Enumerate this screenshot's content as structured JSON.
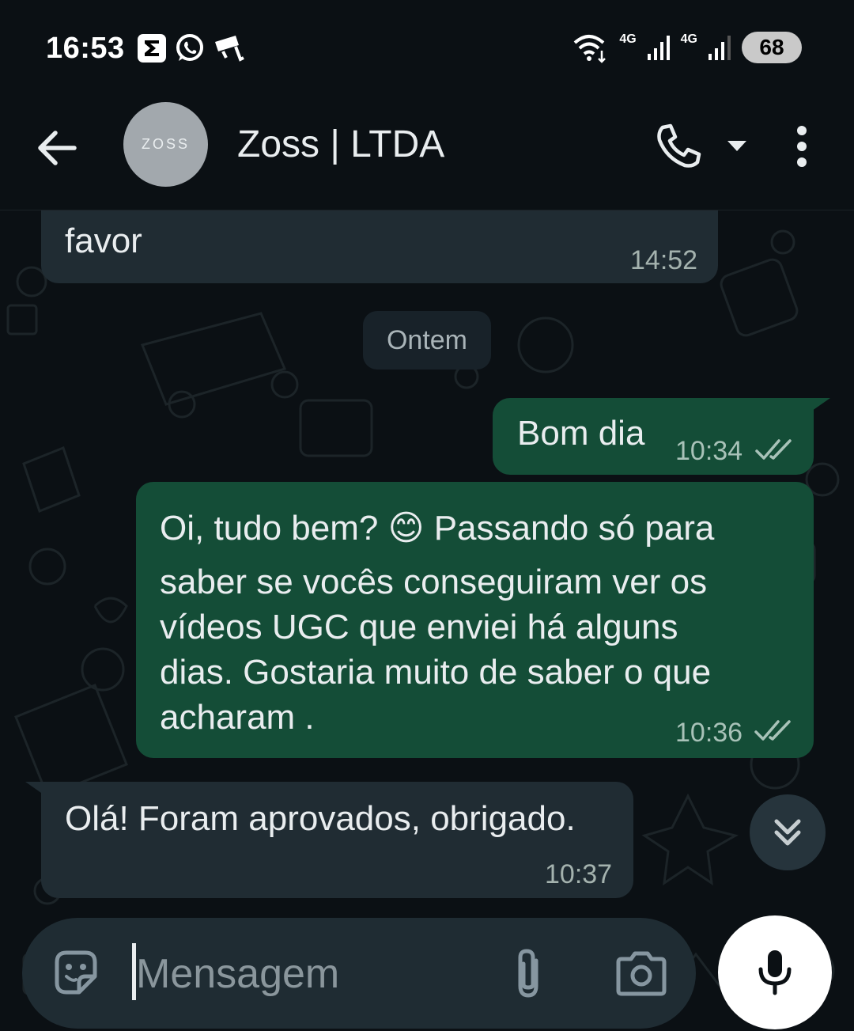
{
  "status_bar": {
    "time": "16:53",
    "net_1": "4G",
    "net_2": "4G",
    "battery": "68"
  },
  "header": {
    "avatar_text": "ZOSS",
    "contact_name": "Zoss | LTDA"
  },
  "messages": [
    {
      "direction": "in",
      "text": "favor",
      "time": "14:52"
    },
    {
      "direction": "out",
      "text": "Bom dia",
      "time": "10:34",
      "status": "read"
    },
    {
      "direction": "out",
      "text_1": "Oi, tudo bem? 😊 Passando só para",
      "text_2": "saber se vocês conseguiram ver os",
      "text_3": "vídeos UGC que enviei há alguns",
      "text_4": "dias. Gostaria muito de saber o que",
      "text_5": "acharam .",
      "time": "10:36",
      "status": "read"
    },
    {
      "direction": "in",
      "text": "Olá! Foram aprovados, obrigado.",
      "time": "10:37"
    }
  ],
  "date_separator": "Ontem",
  "composer": {
    "placeholder": "Mensagem"
  },
  "colors": {
    "background": "#0b1014",
    "incoming_bubble": "#202c33",
    "outgoing_bubble": "#144d37",
    "read_ticks": "#a8c2b8"
  },
  "icons": [
    "back-arrow-icon",
    "phone-icon",
    "dropdown-caret-icon",
    "more-vert-icon",
    "double-chevron-down-icon",
    "sticker-icon",
    "paperclip-icon",
    "camera-icon",
    "mic-icon",
    "double-check-icon",
    "wifi-icon",
    "signal-icon",
    "whatsapp-icon",
    "notification-icon"
  ]
}
